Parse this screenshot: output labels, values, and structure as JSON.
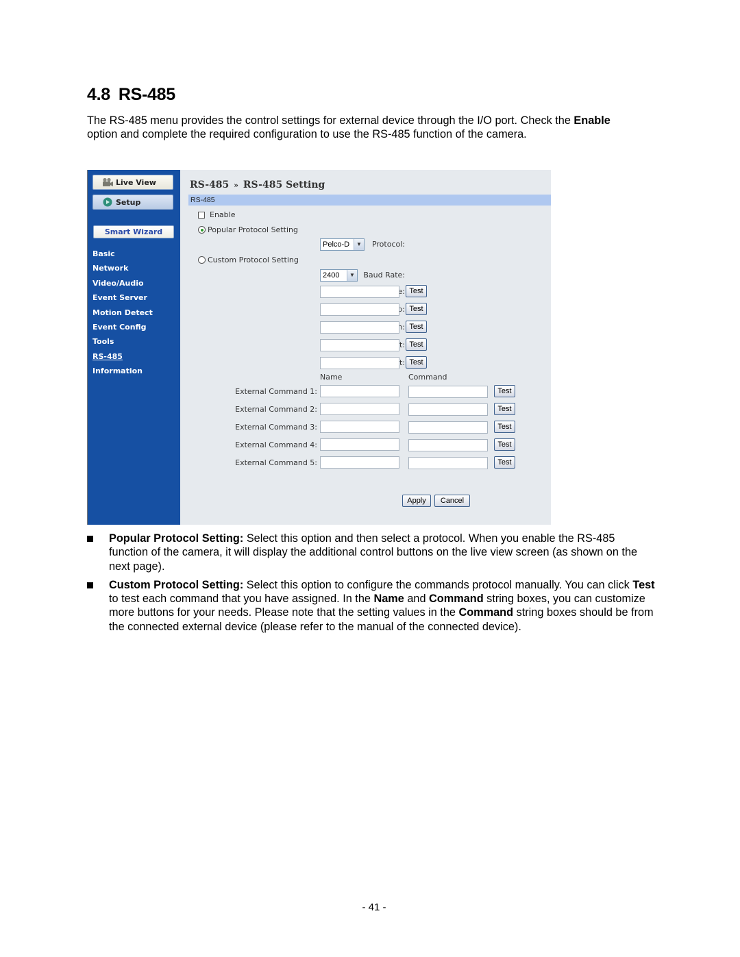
{
  "heading": {
    "number": "4.8",
    "title": "RS-485"
  },
  "intro": {
    "part1": "The RS-485 menu provides the control settings for external device through the I/O port. Check the ",
    "bold": "Enable",
    "part2": " option and complete the required configuration to use the RS-485 function of the camera."
  },
  "screenshot": {
    "sidebar": {
      "live_view": "Live View",
      "setup": "Setup",
      "smart_wizard": "Smart Wizard",
      "menu": [
        "Basic",
        "Network",
        "Video/Audio",
        "Event Server",
        "Motion Detect",
        "Event Config",
        "Tools",
        "RS-485",
        "Information"
      ],
      "active_item": "RS-485"
    },
    "breadcrumb": {
      "parent": "RS-485",
      "separator": "»",
      "current": "RS-485 Setting"
    },
    "section_title": "RS-485",
    "enable": {
      "label": "Enable",
      "checked": false
    },
    "popular": {
      "label": "Popular Protocol Setting",
      "selected": true,
      "protocol_label": "Protocol:",
      "protocol_value": "Pelco-D"
    },
    "custom": {
      "label": "Custom Protocol Setting",
      "selected": false,
      "baud_label": "Baud Rate:",
      "baud_value": "2400"
    },
    "directions": [
      {
        "label": "Home:",
        "value": "",
        "button": "Test"
      },
      {
        "label": "Up:",
        "value": "",
        "button": "Test"
      },
      {
        "label": "Down:",
        "value": "",
        "button": "Test"
      },
      {
        "label": "Left:",
        "value": "",
        "button": "Test"
      },
      {
        "label": "Right:",
        "value": "",
        "button": "Test"
      }
    ],
    "columns": {
      "name": "Name",
      "command": "Command"
    },
    "external_commands": [
      {
        "label": "External Command 1:",
        "name": "",
        "command": "",
        "button": "Test"
      },
      {
        "label": "External Command 2:",
        "name": "",
        "command": "",
        "button": "Test"
      },
      {
        "label": "External Command 3:",
        "name": "",
        "command": "",
        "button": "Test"
      },
      {
        "label": "External Command 4:",
        "name": "",
        "command": "",
        "button": "Test"
      },
      {
        "label": "External Command 5:",
        "name": "",
        "command": "",
        "button": "Test"
      }
    ],
    "apply": "Apply",
    "cancel": "Cancel"
  },
  "bullets": [
    {
      "bold": "Popular Protocol Setting:",
      "text": " Select this option and then select a protocol. When you enable the RS-485 function of the camera, it will display the additional control buttons on the live view screen (as shown on the next page)."
    },
    {
      "bold": "Custom Protocol Setting:",
      "t1": " Select this option to configure the commands protocol manually. You can click ",
      "b1": "Test",
      "t2": " to test each command that you have assigned. In the ",
      "b2": "Name",
      "t3": " and ",
      "b3": "Command",
      "t4": " string boxes, you can customize more buttons for your needs. Please note that the setting values in the ",
      "b4": "Command",
      "t5": " string boxes should be from the connected external device (please refer to the manual of the connected device)."
    }
  ],
  "page_number": "- 41 -",
  "colors": {
    "sidebar": "#1650a3",
    "section_bar": "#afc8f0",
    "content_bg": "#e6eaee"
  }
}
